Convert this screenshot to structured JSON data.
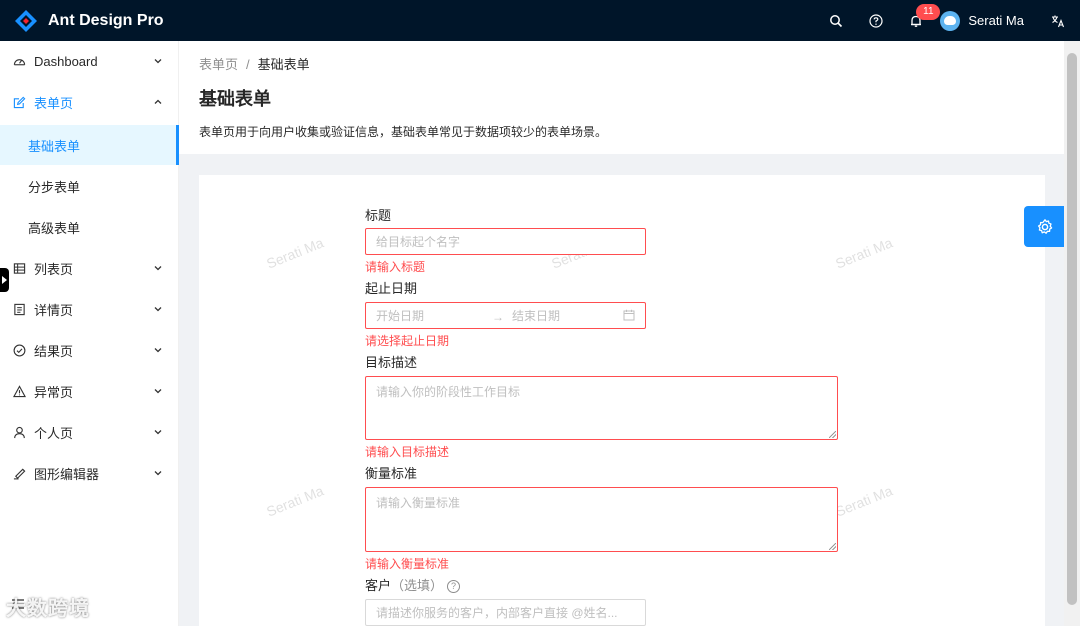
{
  "header": {
    "app_title": "Ant Design Pro",
    "notification_count": "11",
    "user_name": "Serati Ma"
  },
  "sidebar": {
    "items": [
      {
        "label": "Dashboard",
        "icon": "dashboard-icon"
      },
      {
        "label": "表单页",
        "icon": "form-icon"
      },
      {
        "label": "列表页",
        "icon": "table-icon"
      },
      {
        "label": "详情页",
        "icon": "profile-icon"
      },
      {
        "label": "结果页",
        "icon": "check-circle-icon"
      },
      {
        "label": "异常页",
        "icon": "warning-icon"
      },
      {
        "label": "个人页",
        "icon": "user-icon"
      },
      {
        "label": "图形编辑器",
        "icon": "highlight-icon"
      }
    ],
    "form_children": [
      "基础表单",
      "分步表单",
      "高级表单"
    ]
  },
  "breadcrumb": {
    "parent": "表单页",
    "separator": "/",
    "current": "基础表单"
  },
  "page": {
    "title": "基础表单",
    "description": "表单页用于向用户收集或验证信息，基础表单常见于数据项较少的表单场景。"
  },
  "watermark": "Serati Ma",
  "form": {
    "title_label": "标题",
    "title_placeholder": "给目标起个名字",
    "title_error": "请输入标题",
    "date_label": "起止日期",
    "date_start_placeholder": "开始日期",
    "date_arrow": "→",
    "date_end_placeholder": "结束日期",
    "date_error": "请选择起止日期",
    "goal_label": "目标描述",
    "goal_placeholder": "请输入你的阶段性工作目标",
    "goal_error": "请输入目标描述",
    "standard_label": "衡量标准",
    "standard_placeholder": "请输入衡量标准",
    "standard_error": "请输入衡量标准",
    "client_label": "客户",
    "client_hint": "（选填）",
    "client_help": "?",
    "client_placeholder": "请描述你服务的客户，内部客户直接 @姓名..."
  },
  "corner_logo": "大数跨境",
  "colors": {
    "header_bg": "#001529",
    "primary": "#1890ff",
    "error": "#ff4d4f"
  }
}
